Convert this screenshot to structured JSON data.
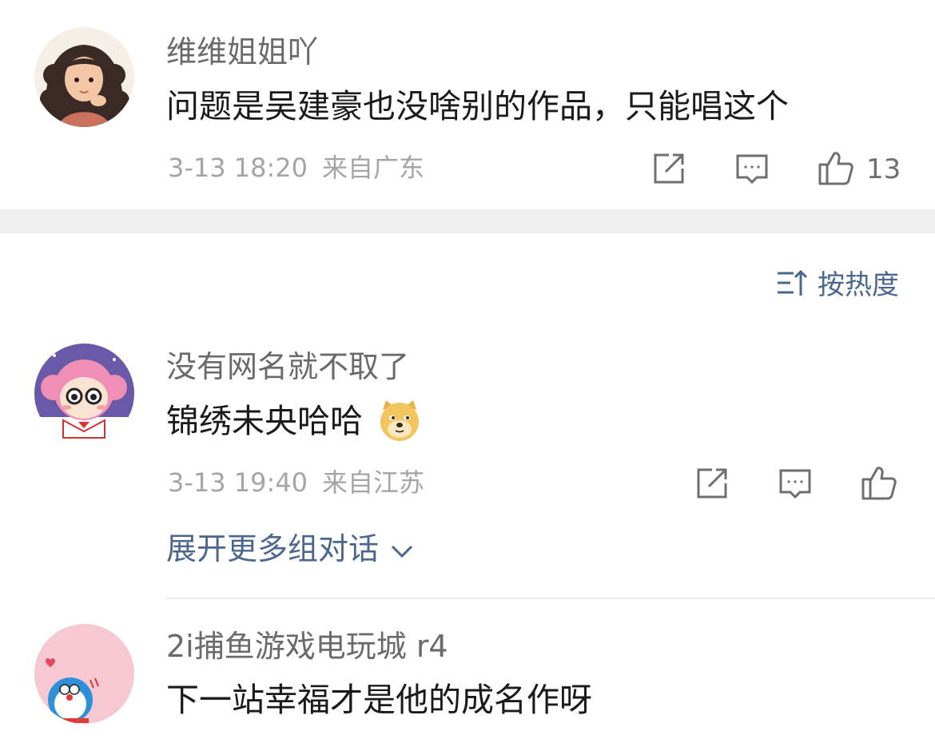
{
  "comment1": {
    "username": "维维姐姐吖",
    "text": "问题是吴建豪也没啥别的作品，只能唱这个",
    "time": "3-13 18:20",
    "location": "来自广东",
    "like_count": "13"
  },
  "sort": {
    "label": "按热度"
  },
  "comment2": {
    "username": "没有网名就不取了",
    "text": "锦绣未央哈哈",
    "emoji": "doge-emoji",
    "time": "3-13 19:40",
    "location": "来自江苏",
    "expand_label": "展开更多组对话"
  },
  "comment3": {
    "username": "2i捕鱼游戏电玩城 r4",
    "text": "下一站幸福才是他的成名作呀"
  },
  "icons": {
    "repost": "repost-icon",
    "comment": "comment-icon",
    "like": "like-icon",
    "sort": "sort-icon",
    "chevron": "chevron-down-icon"
  },
  "colors": {
    "link": "#4b6790",
    "meta": "#a5a5a5",
    "username": "#6a6a6a",
    "text": "#1a1a1a"
  }
}
